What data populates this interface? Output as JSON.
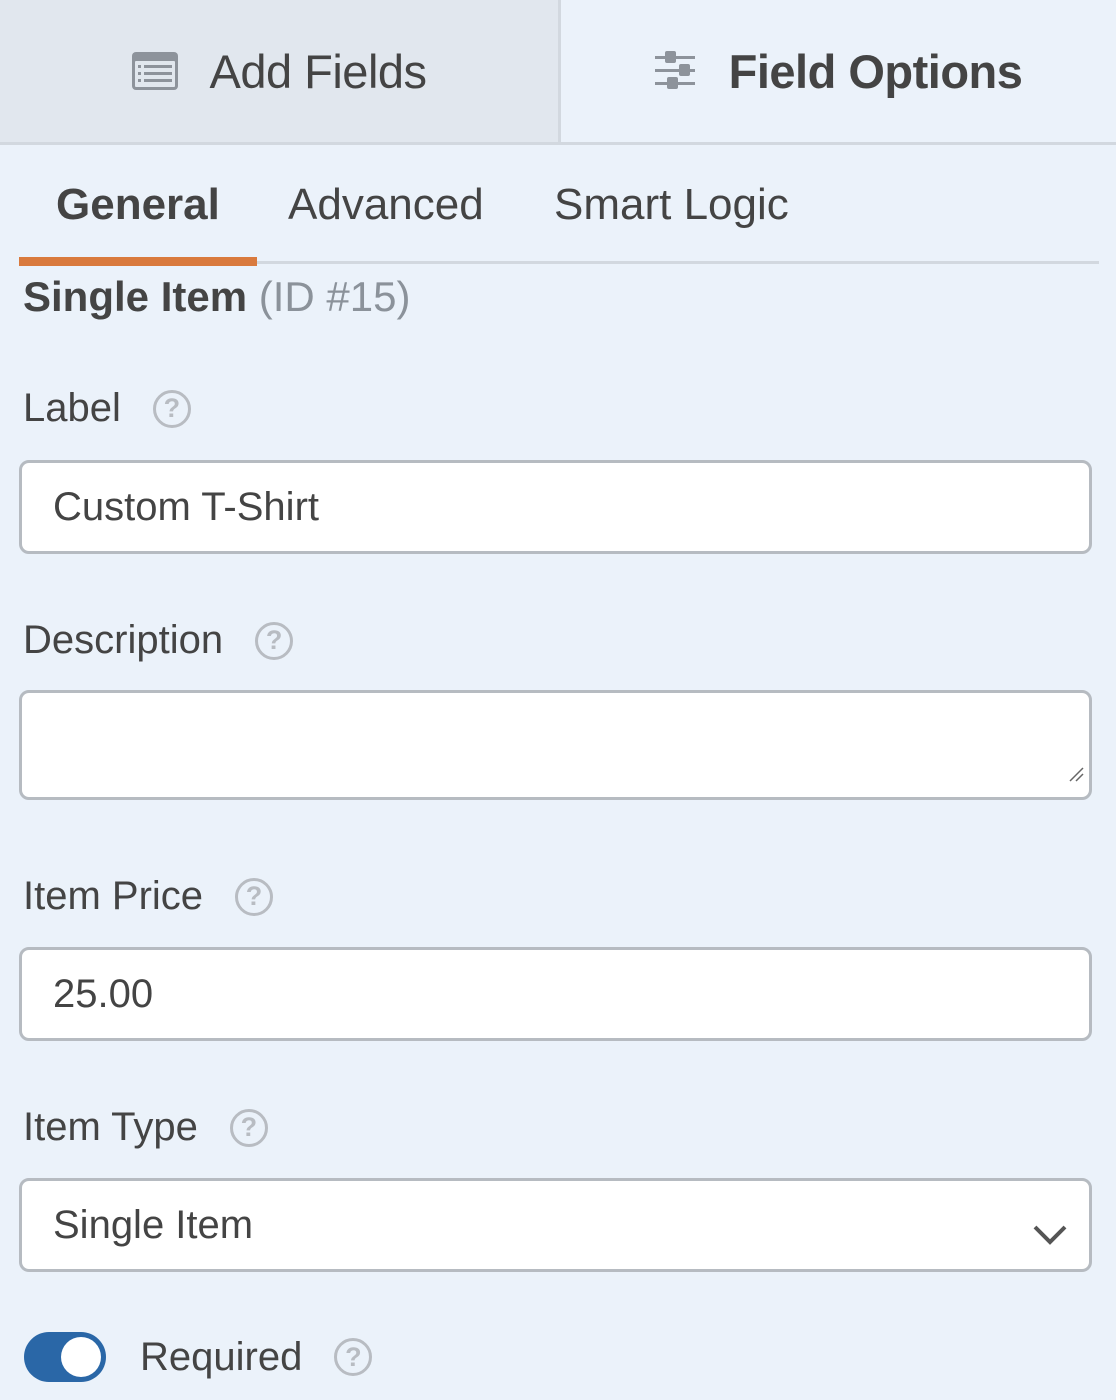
{
  "top_tabs": [
    {
      "label": "Add Fields",
      "icon": "list-icon",
      "active": false
    },
    {
      "label": "Field Options",
      "icon": "sliders-icon",
      "active": true
    }
  ],
  "sub_tabs": [
    {
      "label": "General",
      "active": true
    },
    {
      "label": "Advanced",
      "active": false
    },
    {
      "label": "Smart Logic",
      "active": false
    }
  ],
  "field_heading": {
    "title": "Single Item",
    "id_text": "(ID #15)"
  },
  "label_field": {
    "label": "Label",
    "value": "Custom T-Shirt"
  },
  "description_field": {
    "label": "Description",
    "value": ""
  },
  "price_field": {
    "label": "Item Price",
    "value": "25.00"
  },
  "type_field": {
    "label": "Item Type",
    "selected": "Single Item"
  },
  "required_toggle": {
    "label": "Required",
    "on": true
  },
  "help_glyph": "?",
  "colors": {
    "accent_tab": "#d97a3d",
    "toggle_on": "#2a67a7"
  }
}
